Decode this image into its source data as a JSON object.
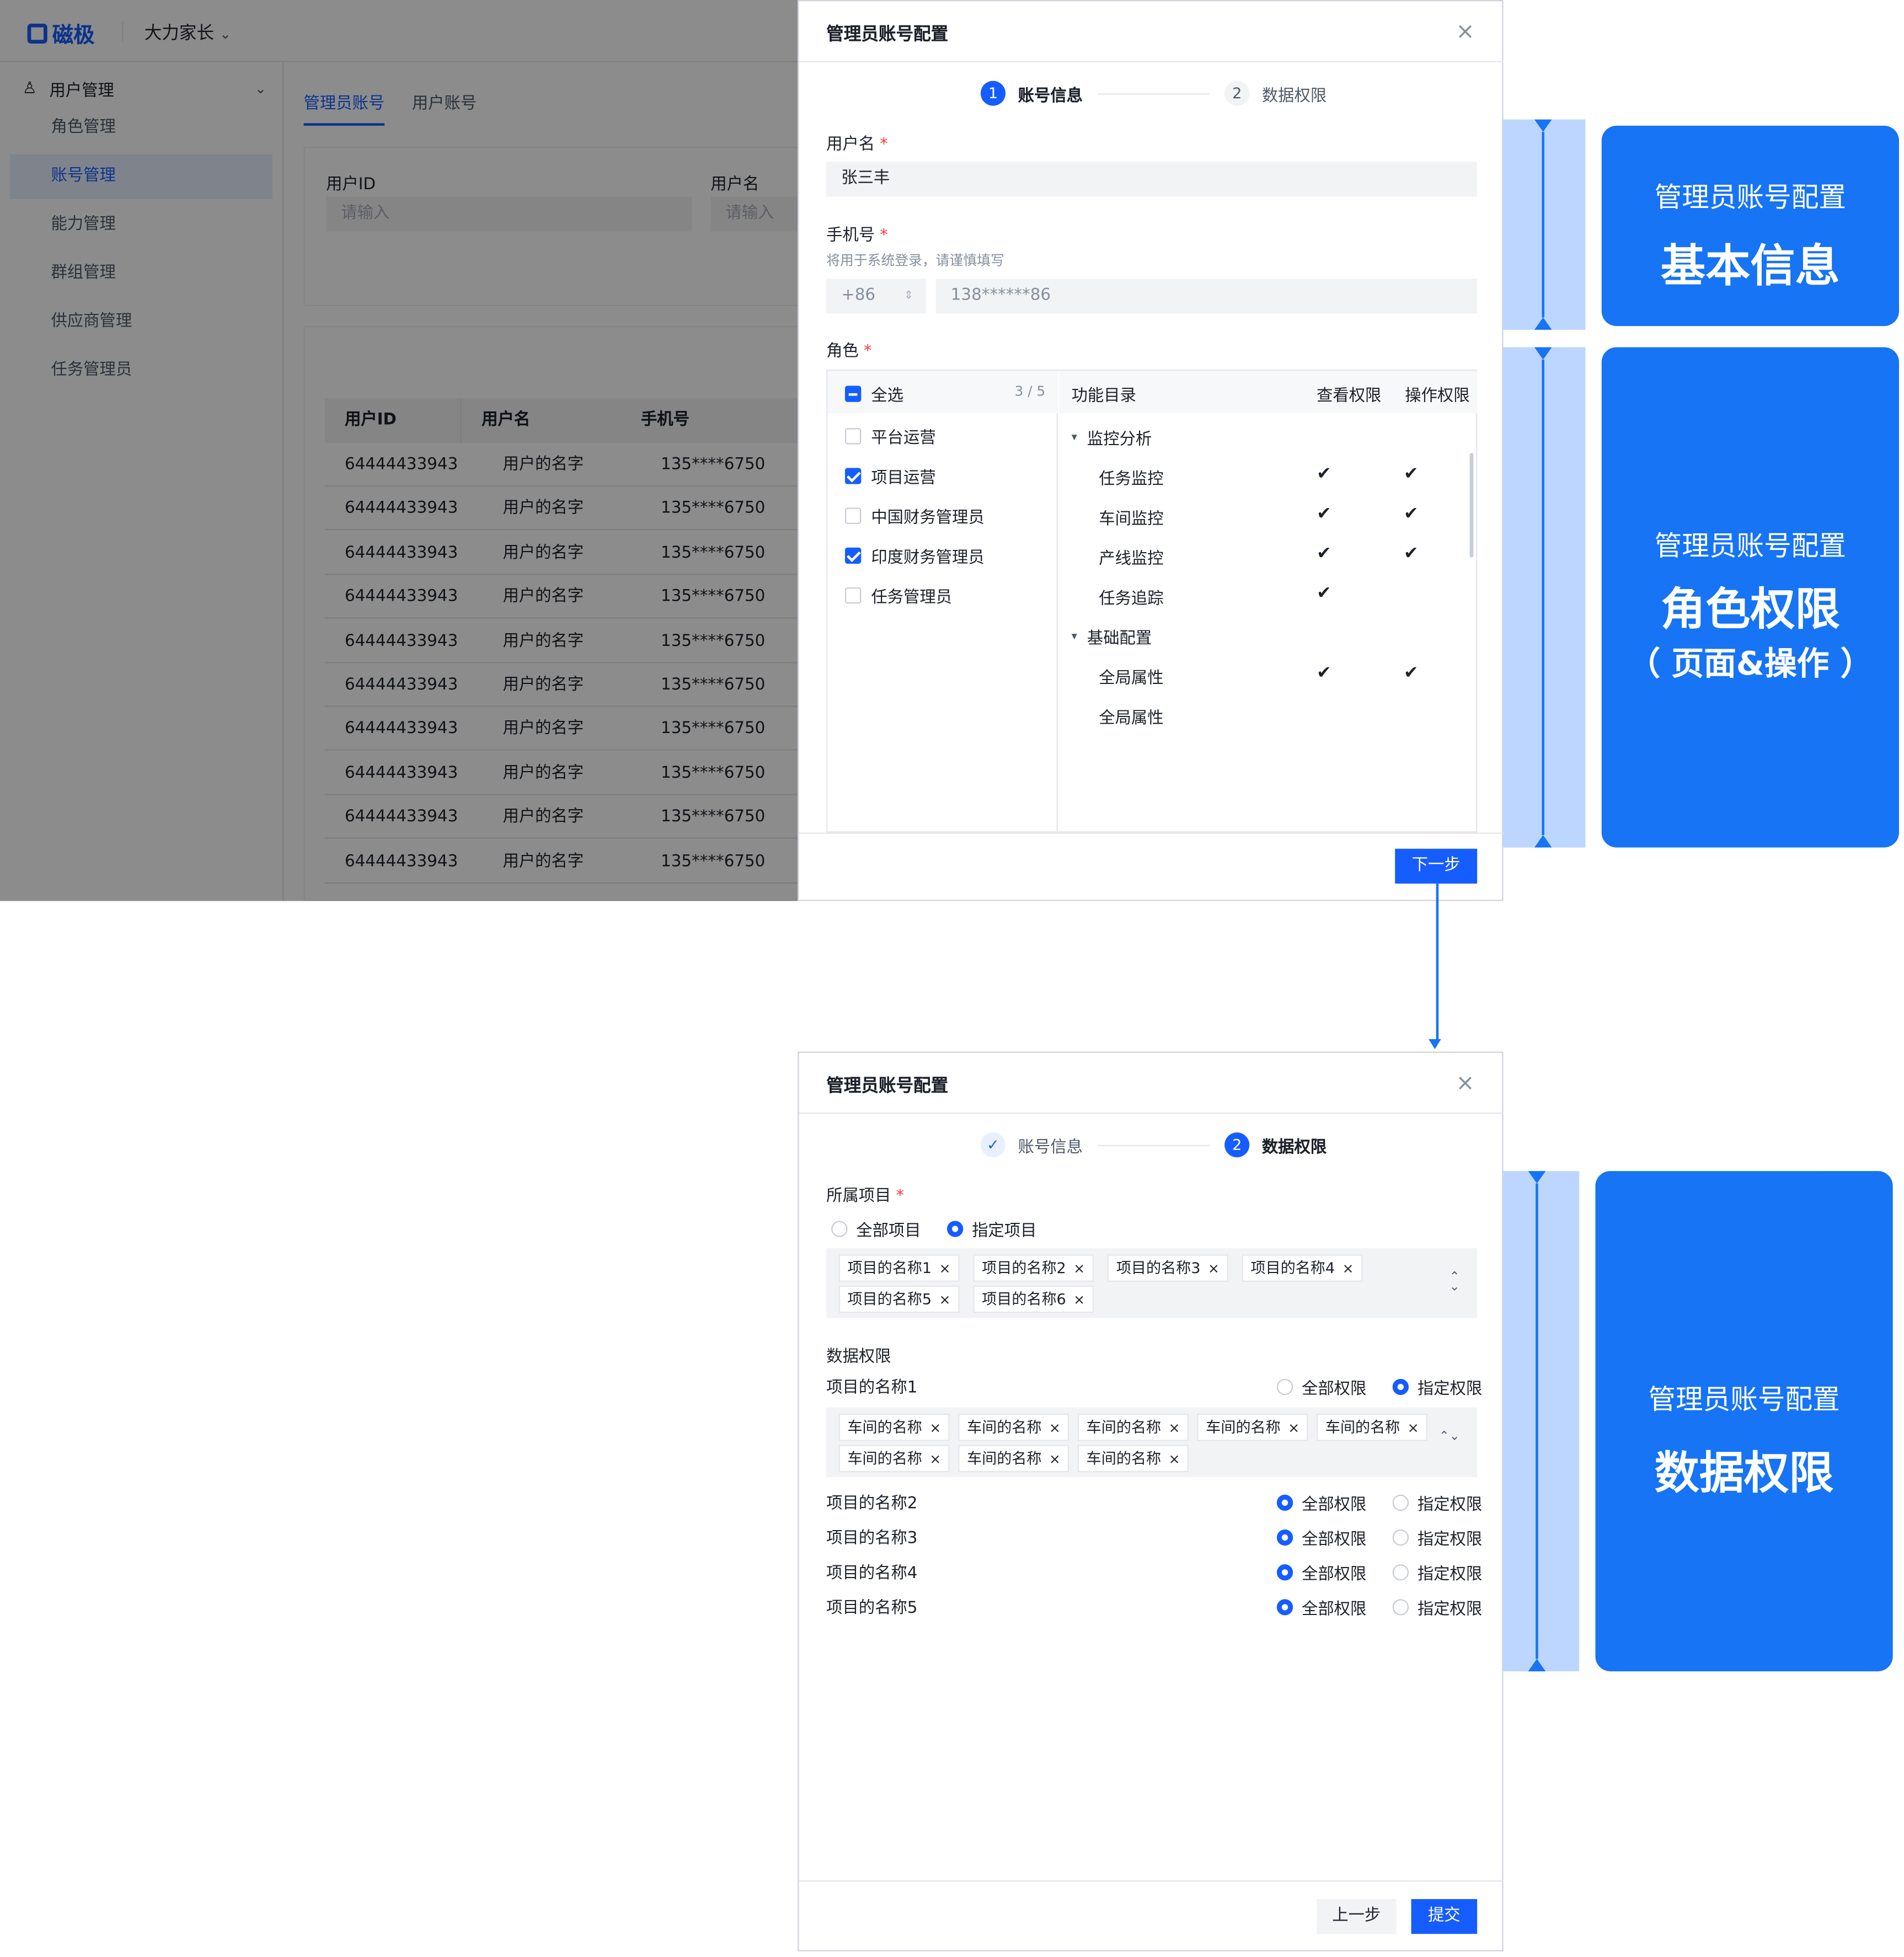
{
  "app": {
    "logo": "磁极",
    "org": "大力家长",
    "org_chevron": "⌄",
    "menu_group": "用户管理",
    "menu_items": [
      "角色管理",
      "账号管理",
      "能力管理",
      "群组管理",
      "供应商管理",
      "任务管理员"
    ],
    "tabs": [
      "管理员账号",
      "用户账号"
    ],
    "filter": {
      "label1": "用户ID",
      "label2": "用户名",
      "placeholder": "请输入"
    },
    "table": {
      "headers": [
        "用户ID",
        "用户名",
        "手机号"
      ],
      "rows": [
        [
          "64444433943",
          "用户的名字",
          "135****6750"
        ],
        [
          "64444433943",
          "用户的名字",
          "135****6750"
        ],
        [
          "64444433943",
          "用户的名字",
          "135****6750"
        ],
        [
          "64444433943",
          "用户的名字",
          "135****6750"
        ],
        [
          "64444433943",
          "用户的名字",
          "135****6750"
        ],
        [
          "64444433943",
          "用户的名字",
          "135****6750"
        ],
        [
          "64444433943",
          "用户的名字",
          "135****6750"
        ],
        [
          "64444433943",
          "用户的名字",
          "135****6750"
        ],
        [
          "64444433943",
          "用户的名字",
          "135****6750"
        ],
        [
          "64444433943",
          "用户的名字",
          "135****6750"
        ]
      ]
    }
  },
  "modal1": {
    "title": "管理员账号配置",
    "close": "×",
    "step1_num": "1",
    "step1_label": "账号信息",
    "step2_num": "2",
    "step2_label": "数据权限",
    "username_label": "用户名",
    "required": "*",
    "username_value": "张三丰",
    "phone_label": "手机号",
    "phone_hint": "将用于系统登录，请谨慎填写",
    "phone_code": "+86",
    "phone_value": "138******86",
    "role_label": "角色",
    "select_all": "全选",
    "select_count": "3 / 5",
    "roles": [
      {
        "name": "平台运营",
        "checked": false
      },
      {
        "name": "项目运营",
        "checked": true
      },
      {
        "name": "中国财务管理员",
        "checked": false
      },
      {
        "name": "印度财务管理员",
        "checked": true
      },
      {
        "name": "任务管理员",
        "checked": false
      }
    ],
    "perm_headers": [
      "功能目录",
      "查看权限",
      "操作权限"
    ],
    "groups": [
      {
        "name": "监控分析",
        "items": [
          {
            "name": "任务监控",
            "view": true,
            "op": true
          },
          {
            "name": "车间监控",
            "view": true,
            "op": true
          },
          {
            "name": "产线监控",
            "view": true,
            "op": true
          },
          {
            "name": "任务追踪",
            "view": true,
            "op": false
          }
        ]
      },
      {
        "name": "基础配置",
        "items": [
          {
            "name": "全局属性",
            "view": true,
            "op": true
          },
          {
            "name": "全局属性",
            "view": false,
            "op": false
          }
        ]
      }
    ],
    "check_glyph": "✔",
    "caret": "▾",
    "next_button": "下一步"
  },
  "modal2": {
    "title": "管理员账号配置",
    "close": "×",
    "step1_check": "✓",
    "step1_label": "账号信息",
    "step2_num": "2",
    "step2_label": "数据权限",
    "project_label": "所属项目",
    "required": "*",
    "opt_all_projects": "全部项目",
    "opt_specific_projects": "指定项目",
    "project_tags": [
      "项目的名称1",
      "项目的名称2",
      "项目的名称3",
      "项目的名称4",
      "项目的名称5",
      "项目的名称6"
    ],
    "tag_close": "×",
    "updown": "⌃⌄",
    "data_perm_label": "数据权限",
    "opt_all_perm": "全部权限",
    "opt_specific_perm": "指定权限",
    "projects": [
      {
        "name": "项目的名称1",
        "mode": "specific"
      },
      {
        "name": "项目的名称2",
        "mode": "all"
      },
      {
        "name": "项目的名称3",
        "mode": "all"
      },
      {
        "name": "项目的名称4",
        "mode": "all"
      },
      {
        "name": "项目的名称5",
        "mode": "all"
      }
    ],
    "workshop_tags": [
      "车间的名称",
      "车间的名称",
      "车间的名称",
      "车间的名称",
      "车间的名称",
      "车间的名称",
      "车间的名称",
      "车间的名称"
    ],
    "prev_button": "上一步",
    "submit_button": "提交"
  },
  "annotations": {
    "card1": {
      "sub": "管理员账号配置",
      "big": "基本信息"
    },
    "card2": {
      "sub": "管理员账号配置",
      "big": "角色权限",
      "extra": "（ 页面&操作 ）"
    },
    "card3": {
      "sub": "管理员账号配置",
      "big": "数据权限"
    }
  },
  "colors": {
    "primary": "#165dff",
    "annotation": "#1674f5",
    "bracket": "#bcd6ff"
  }
}
